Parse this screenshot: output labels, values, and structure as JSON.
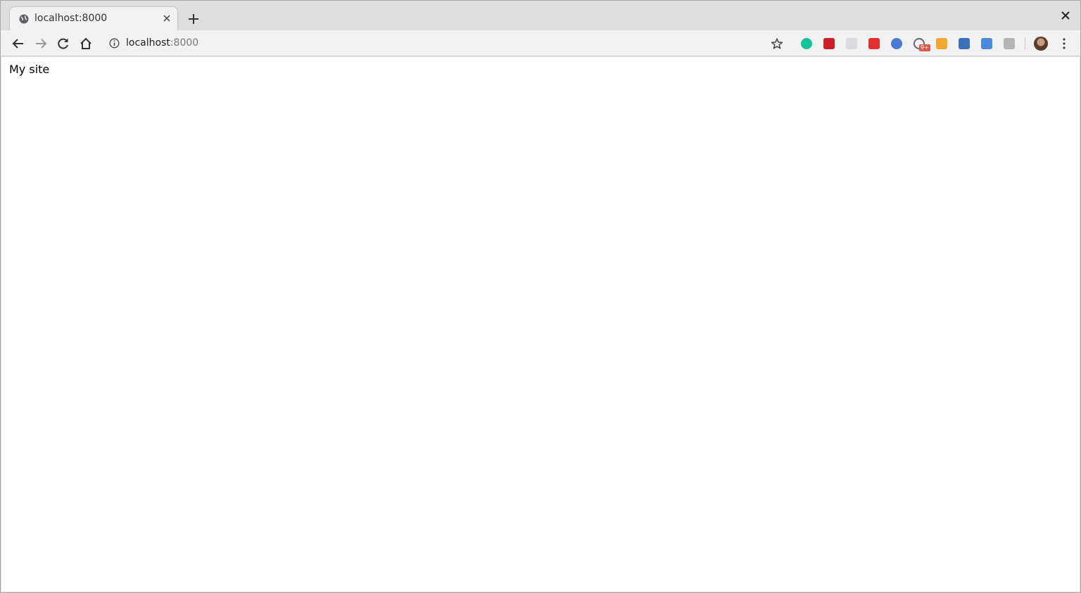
{
  "tab": {
    "title": "localhost:8000"
  },
  "omnibox": {
    "host": "localhost",
    "port": ":8000"
  },
  "extensions": [
    {
      "name": "grammarly-icon",
      "color": "#15c39a"
    },
    {
      "name": "lastpass-icon",
      "color": "#cc2029"
    },
    {
      "name": "react-devtools-icon",
      "color": "#d8dbe0"
    },
    {
      "name": "adblock-icon",
      "color": "#e22f2f"
    },
    {
      "name": "circle-extension-icon",
      "color": "#4a7bd0"
    },
    {
      "name": "notification-extension-icon",
      "color": "#666666",
      "badge": "9+"
    },
    {
      "name": "sketch-extension-icon",
      "color": "#f0a830"
    },
    {
      "name": "save-extension-icon",
      "color": "#3c6fb8"
    },
    {
      "name": "google-translate-icon",
      "color": "#4a89dc"
    },
    {
      "name": "gray-extension-icon",
      "color": "#b5b5b5"
    }
  ],
  "page": {
    "text": "My site"
  }
}
